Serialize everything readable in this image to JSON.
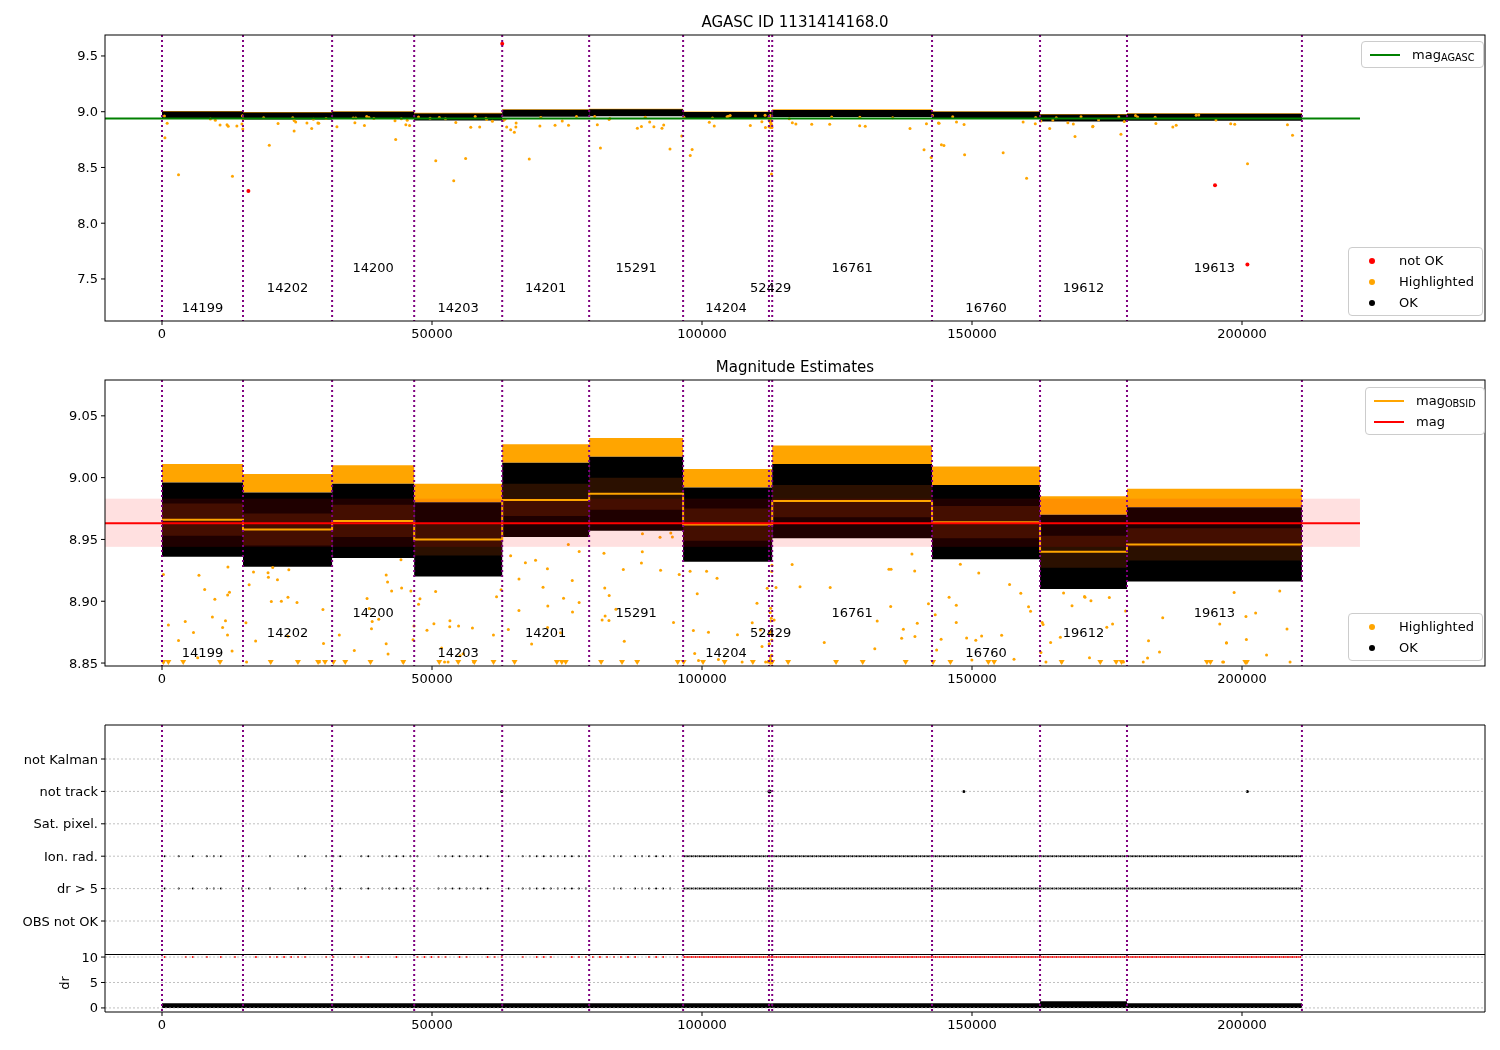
{
  "panels": [
    {
      "title": "AGASC ID 1131414168.0",
      "chart_data": {
        "type": "line",
        "xlim": [
          -10556,
          245000
        ],
        "ylim": [
          7.123,
          9.688
        ],
        "xticks": [
          0,
          50000,
          100000,
          150000,
          200000
        ],
        "yticks": [
          {
            "value": 7.5,
            "label": "7.5"
          },
          {
            "value": 8.0,
            "label": "8.0"
          },
          {
            "value": 8.5,
            "label": "8.5"
          },
          {
            "value": 9.0,
            "label": "9.0"
          },
          {
            "value": 9.5,
            "label": "9.5"
          }
        ],
        "series": [
          {
            "name": "mag$_{AGASC}$",
            "color": "#008000",
            "x": [
              -10556,
              221850
            ],
            "values": [
              8.94,
              8.94
            ]
          }
        ],
        "ref_lines": [
          {
            "axis": "x",
            "value": 0
          },
          {
            "axis": "x",
            "value": 15000
          },
          {
            "axis": "x",
            "value": 31500
          },
          {
            "axis": "x",
            "value": 46700
          },
          {
            "axis": "x",
            "value": 63000
          },
          {
            "axis": "x",
            "value": 79100
          },
          {
            "axis": "x",
            "value": 96500
          },
          {
            "axis": "x",
            "value": 112400
          },
          {
            "axis": "x",
            "value": 113000
          },
          {
            "axis": "x",
            "value": 142600
          },
          {
            "axis": "x",
            "value": 162600
          },
          {
            "axis": "x",
            "value": 178700
          },
          {
            "axis": "x",
            "value": 211100
          }
        ],
        "annotations": [
          "14199",
          "14202",
          "14200",
          "14203",
          "14201",
          "15291",
          "14204",
          "52429",
          "16761",
          "16760",
          "19612",
          "19613"
        ]
      },
      "point_legend": [
        {
          "label": "not OK",
          "color": "#ff0000"
        },
        {
          "label": "Highlighted",
          "color": "#ffa500"
        },
        {
          "label": "OK",
          "color": "#000000"
        }
      ]
    },
    {
      "title": "Magnitude Estimates",
      "chart_data": {
        "type": "line",
        "xlim": [
          -10556,
          245000
        ],
        "ylim": [
          8.8476,
          9.079
        ],
        "xticks": [
          0,
          50000,
          100000,
          150000,
          200000
        ],
        "yticks": [
          {
            "value": 8.85,
            "label": "8.85"
          },
          {
            "value": 8.9,
            "label": "8.90"
          },
          {
            "value": 8.95,
            "label": "8.95"
          },
          {
            "value": 9.0,
            "label": "9.00"
          },
          {
            "value": 9.05,
            "label": "9.05"
          }
        ],
        "series": [
          {
            "name": "mag$_{OBSID}$",
            "color": "#ffa500",
            "x": [
              0,
              15000,
              15000,
              31500,
              31500,
              46700,
              46700,
              63000,
              63000,
              79100,
              79100,
              96500,
              96500,
              112400,
              112400,
              113000,
              113000,
              142600,
              142600,
              162600,
              162600,
              178700,
              178700,
              211100
            ],
            "values": [
              8.966,
              8.966,
              8.958,
              8.958,
              8.965,
              8.965,
              8.95,
              8.95,
              8.982,
              8.982,
              8.987,
              8.987,
              8.962,
              8.962,
              8.962,
              8.962,
              8.981,
              8.981,
              8.964,
              8.964,
              8.94,
              8.94,
              8.946,
              8.946
            ]
          },
          {
            "name": "mag",
            "color": "#ff0000",
            "x": [
              -10556,
              221850
            ],
            "values": [
              8.963,
              8.963
            ]
          }
        ],
        "bands": [
          {
            "axis": "y",
            "from": 8.944,
            "to": 8.983
          }
        ],
        "ref_lines": [
          {
            "axis": "x",
            "value": 0
          },
          {
            "axis": "x",
            "value": 15000
          },
          {
            "axis": "x",
            "value": 31500
          },
          {
            "axis": "x",
            "value": 46700
          },
          {
            "axis": "x",
            "value": 63000
          },
          {
            "axis": "x",
            "value": 79100
          },
          {
            "axis": "x",
            "value": 96500
          },
          {
            "axis": "x",
            "value": 112400
          },
          {
            "axis": "x",
            "value": 113000
          },
          {
            "axis": "x",
            "value": 142600
          },
          {
            "axis": "x",
            "value": 162600
          },
          {
            "axis": "x",
            "value": 178700
          },
          {
            "axis": "x",
            "value": 211100
          }
        ],
        "annotations": [
          "14199",
          "14202",
          "14200",
          "14203",
          "14201",
          "15291",
          "14204",
          "52429",
          "16761",
          "16760",
          "19612",
          "19613"
        ]
      },
      "point_legend": [
        {
          "label": "Highlighted",
          "color": "#ffa500"
        },
        {
          "label": "OK",
          "color": "#000000"
        }
      ]
    },
    {
      "chart_data": {
        "type": "scatter",
        "orientation": "horizontal",
        "grid": true,
        "xlim": [
          -10556,
          245000
        ],
        "categories": [
          "not Kalman",
          "not track",
          "Sat. pixel.",
          "Ion. rad.",
          "dr > 5",
          "OBS not OK"
        ],
        "ref_lines": [
          {
            "axis": "x",
            "value": 0
          },
          {
            "axis": "x",
            "value": 15000
          },
          {
            "axis": "x",
            "value": 31500
          },
          {
            "axis": "x",
            "value": 46700
          },
          {
            "axis": "x",
            "value": 63000
          },
          {
            "axis": "x",
            "value": 79100
          },
          {
            "axis": "x",
            "value": 96500
          },
          {
            "axis": "x",
            "value": 112400
          },
          {
            "axis": "x",
            "value": 113000
          },
          {
            "axis": "x",
            "value": 142600
          },
          {
            "axis": "x",
            "value": 162600
          },
          {
            "axis": "x",
            "value": 178700
          },
          {
            "axis": "x",
            "value": 211100
          }
        ]
      }
    },
    {
      "chart_data": {
        "type": "scatter",
        "ylabel": "dr",
        "grid": true,
        "xlim": [
          -10556,
          245000
        ],
        "ylim": [
          -0.8,
          10.5
        ],
        "xticks": [
          0,
          50000,
          100000,
          150000,
          200000
        ],
        "yticks": [
          0,
          5,
          10
        ],
        "ref_lines": [
          {
            "axis": "x",
            "value": 0
          },
          {
            "axis": "x",
            "value": 15000
          },
          {
            "axis": "x",
            "value": 31500
          },
          {
            "axis": "x",
            "value": 46700
          },
          {
            "axis": "x",
            "value": 63000
          },
          {
            "axis": "x",
            "value": 79100
          },
          {
            "axis": "x",
            "value": 96500
          },
          {
            "axis": "x",
            "value": 112400
          },
          {
            "axis": "x",
            "value": 113000
          },
          {
            "axis": "x",
            "value": 142600
          },
          {
            "axis": "x",
            "value": 162600
          },
          {
            "axis": "x",
            "value": 178700
          },
          {
            "axis": "x",
            "value": 211100
          }
        ]
      }
    }
  ]
}
